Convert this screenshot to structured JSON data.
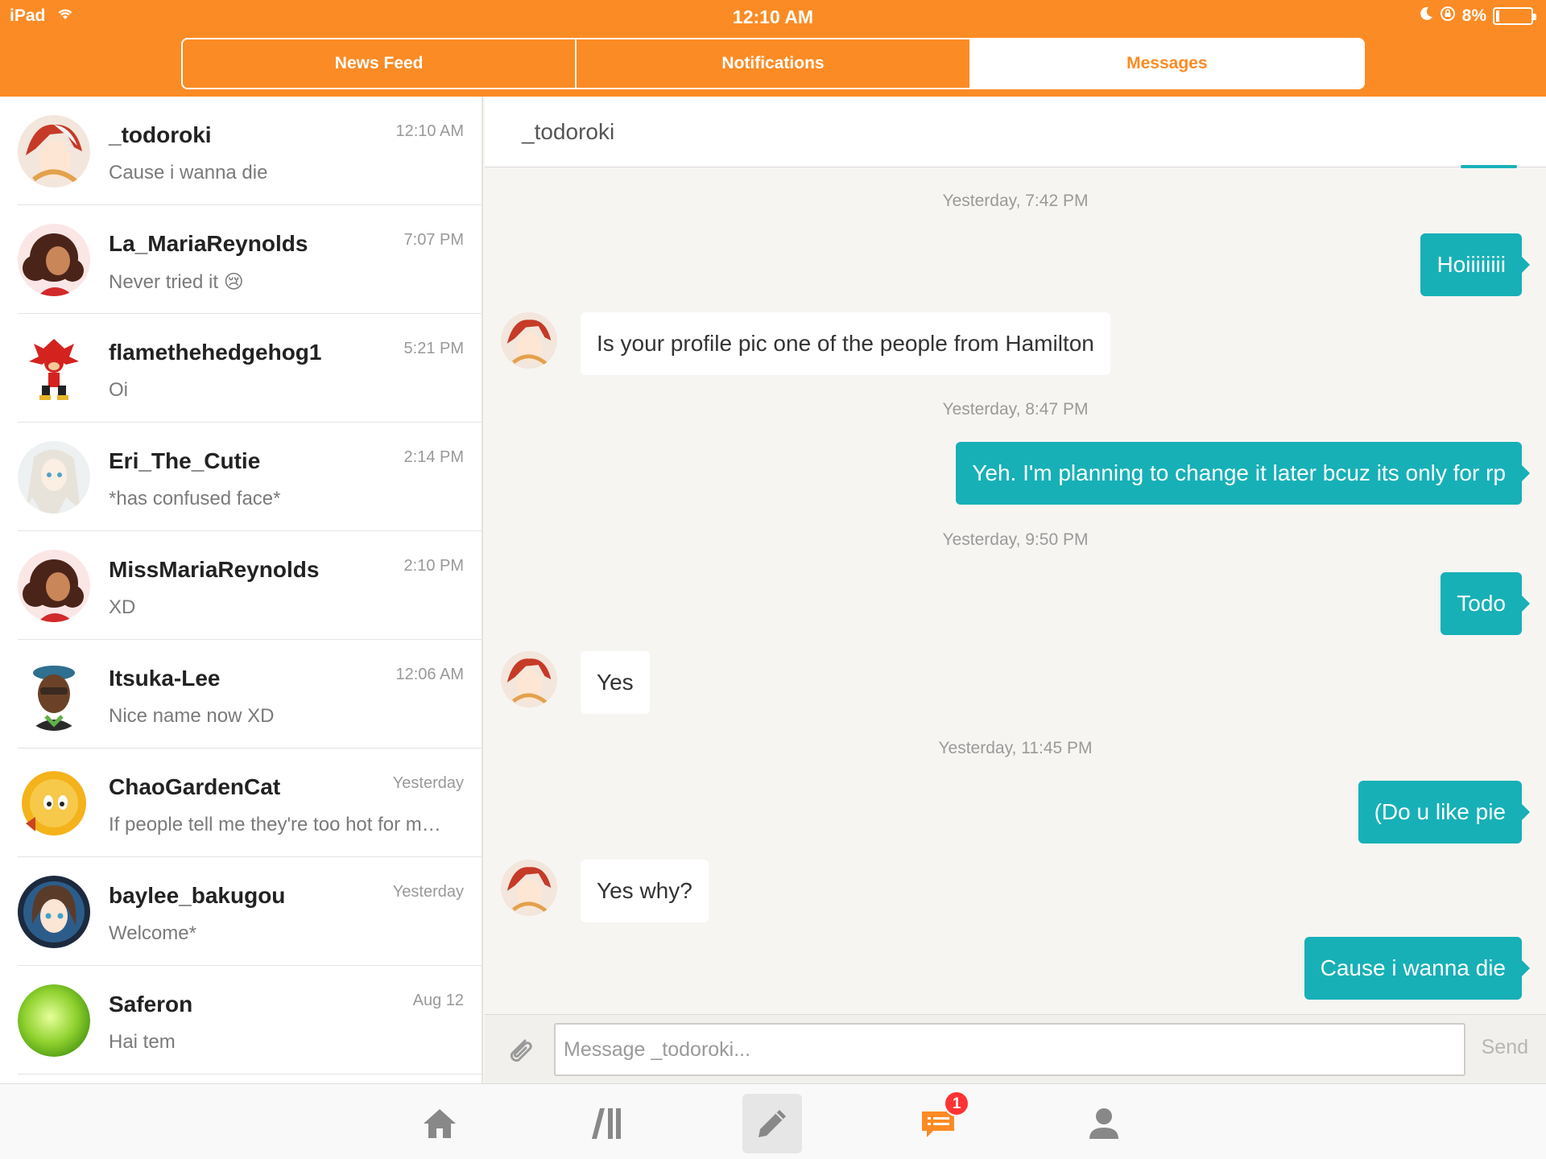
{
  "status_bar": {
    "device": "iPad",
    "time": "12:10 AM",
    "battery_percent": "8%",
    "battery_level": 0.08
  },
  "top_tabs": [
    "News Feed",
    "Notifications",
    "Messages"
  ],
  "active_top_tab": "Messages",
  "conversations": [
    {
      "name": "_todoroki",
      "time": "12:10 AM",
      "preview": "Cause i wanna die"
    },
    {
      "name": "La_MariaReynolds",
      "time": "7:07 PM",
      "preview": "Never tried it 😢"
    },
    {
      "name": "flamethehedgehog1",
      "time": "5:21 PM",
      "preview": "Oi"
    },
    {
      "name": "Eri_The_Cutie",
      "time": "2:14 PM",
      "preview": "*has confused face*"
    },
    {
      "name": "MissMariaReynolds",
      "time": "2:10 PM",
      "preview": "XD"
    },
    {
      "name": "Itsuka-Lee",
      "time": "12:06 AM",
      "preview": "Nice name now XD"
    },
    {
      "name": "ChaoGardenCat",
      "time": "Yesterday",
      "preview": "If people tell me they're too hot for m…"
    },
    {
      "name": "baylee_bakugou",
      "time": "Yesterday",
      "preview": "Welcome*"
    },
    {
      "name": "Saferon",
      "time": "Aug 12",
      "preview": "Hai tem"
    }
  ],
  "chat": {
    "title": "_todoroki",
    "stamps": [
      "Yesterday, 7:42 PM",
      "Yesterday, 8:47 PM",
      "Yesterday, 9:50 PM",
      "Yesterday, 11:45 PM"
    ],
    "messages": [
      "Hoiiiiiiii",
      "Is your profile pic one of the people from Hamilton",
      "Yeh. I'm planning to change it later bcuz its only for rp",
      "Todo",
      "Yes",
      "(Do u like pie",
      "Yes why?",
      "Cause i wanna die"
    ],
    "composer_placeholder": "Message _todoroki...",
    "send_label": "Send"
  },
  "tab_bar": {
    "icons": [
      "home-icon",
      "library-icon",
      "compose-icon",
      "messages-icon",
      "profile-icon"
    ],
    "active": "compose-icon",
    "messages_badge": "1"
  },
  "colors": {
    "brand_orange": "#fb8b24",
    "bubble_teal": "#17b0b7",
    "badge_red": "#ff3333"
  }
}
